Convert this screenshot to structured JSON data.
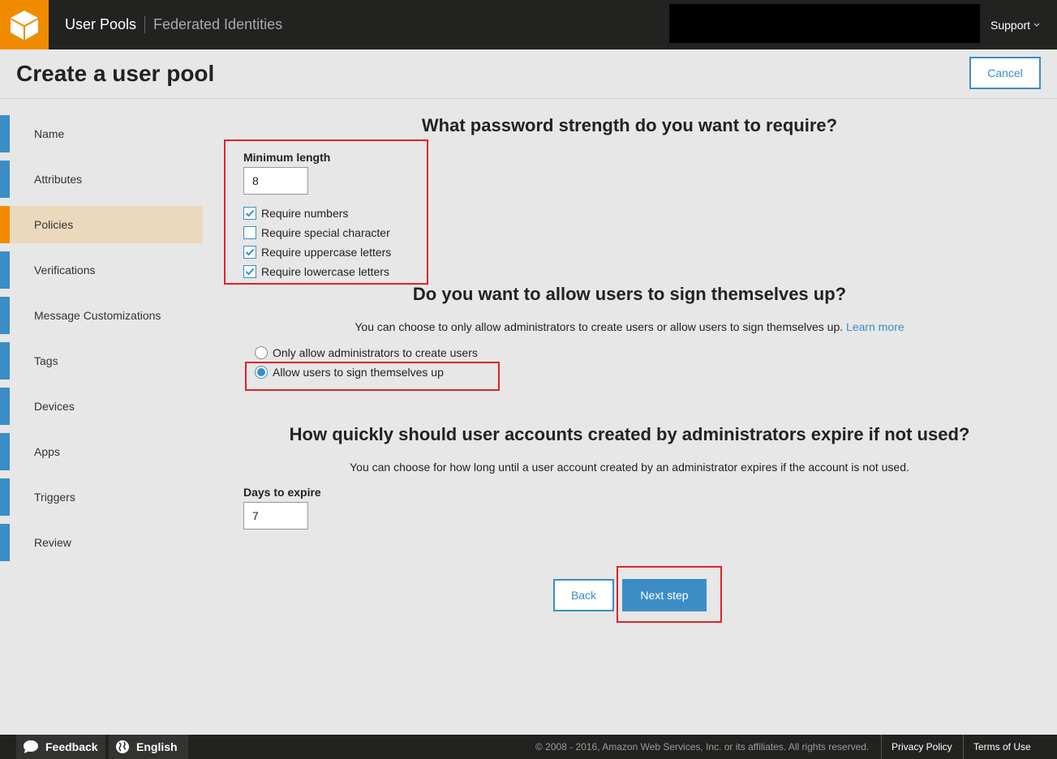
{
  "topbar": {
    "nav_active": "User Pools",
    "nav_other": "Federated Identities",
    "support": "Support"
  },
  "header": {
    "title": "Create a user pool",
    "cancel": "Cancel"
  },
  "sidebar": {
    "items": [
      {
        "label": "Name"
      },
      {
        "label": "Attributes"
      },
      {
        "label": "Policies"
      },
      {
        "label": "Verifications"
      },
      {
        "label": "Message Customizations"
      },
      {
        "label": "Tags"
      },
      {
        "label": "Devices"
      },
      {
        "label": "Apps"
      },
      {
        "label": "Triggers"
      },
      {
        "label": "Review"
      }
    ],
    "active": "Policies"
  },
  "password": {
    "heading": "What password strength do you want to require?",
    "min_length_label": "Minimum length",
    "min_length_value": "8",
    "options": [
      {
        "label": "Require numbers",
        "checked": true
      },
      {
        "label": "Require special character",
        "checked": false
      },
      {
        "label": "Require uppercase letters",
        "checked": true
      },
      {
        "label": "Require lowercase letters",
        "checked": true
      }
    ]
  },
  "signup": {
    "heading": "Do you want to allow users to sign themselves up?",
    "desc": "You can choose to only allow administrators to create users or allow users to sign themselves up.",
    "learn_more": "Learn more",
    "options": [
      {
        "label": "Only allow administrators to create users",
        "selected": false
      },
      {
        "label": "Allow users to sign themselves up",
        "selected": true
      }
    ]
  },
  "expire": {
    "heading": "How quickly should user accounts created by administrators expire if not used?",
    "desc": "You can choose for how long until a user account created by an administrator expires if the account is not used.",
    "days_label": "Days to expire",
    "days_value": "7"
  },
  "actions": {
    "back": "Back",
    "next": "Next step"
  },
  "footer": {
    "feedback": "Feedback",
    "language": "English",
    "copyright": "© 2008 - 2016, Amazon Web Services, Inc. or its affiliates. All rights reserved.",
    "privacy": "Privacy Policy",
    "terms": "Terms of Use"
  },
  "colors": {
    "accent": "#3c8dc6",
    "brand": "#f08b00",
    "highlight": "#e3202a"
  }
}
